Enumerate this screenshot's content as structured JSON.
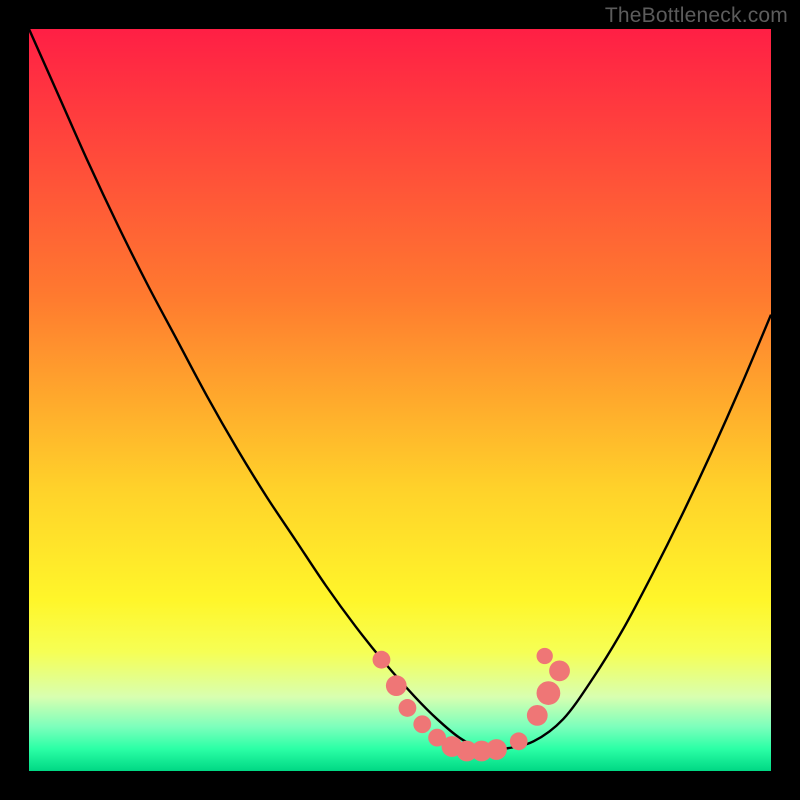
{
  "watermark": "TheBottleneck.com",
  "chart_data": {
    "type": "line",
    "title": "",
    "xlabel": "",
    "ylabel": "",
    "xlim": [
      0,
      100
    ],
    "ylim": [
      0,
      100
    ],
    "grid": false,
    "gradient_stops": [
      {
        "pct": 0,
        "color": "#ff1f45"
      },
      {
        "pct": 36,
        "color": "#ff7a2f"
      },
      {
        "pct": 62,
        "color": "#ffd22a"
      },
      {
        "pct": 77,
        "color": "#fff62a"
      },
      {
        "pct": 84,
        "color": "#f6ff55"
      },
      {
        "pct": 90,
        "color": "#d8ffb0"
      },
      {
        "pct": 94,
        "color": "#7dffbc"
      },
      {
        "pct": 97,
        "color": "#2bffa6"
      },
      {
        "pct": 100,
        "color": "#00d884"
      }
    ],
    "series": [
      {
        "name": "bottleneck-curve",
        "color": "#000000",
        "x": [
          0.0,
          4.0,
          8.0,
          12.0,
          16.0,
          20.0,
          24.0,
          28.0,
          32.0,
          36.0,
          40.0,
          44.0,
          48.0,
          52.0,
          55.0,
          58.0,
          61.0,
          64.0,
          68.0,
          72.0,
          76.0,
          80.0,
          84.0,
          88.0,
          92.0,
          96.0,
          100.0
        ],
        "y": [
          100.0,
          91.0,
          82.0,
          73.5,
          65.5,
          58.0,
          50.5,
          43.5,
          37.0,
          31.0,
          25.0,
          19.5,
          14.5,
          10.0,
          7.0,
          4.5,
          3.0,
          3.0,
          4.0,
          7.0,
          12.5,
          19.0,
          26.5,
          34.5,
          43.0,
          52.0,
          61.5
        ]
      }
    ],
    "markers": [
      {
        "x": 47.5,
        "y": 15.0,
        "r": 1.2,
        "color": "#ef7676"
      },
      {
        "x": 49.5,
        "y": 11.5,
        "r": 1.4,
        "color": "#ef7676"
      },
      {
        "x": 51.0,
        "y": 8.5,
        "r": 1.2,
        "color": "#ef7676"
      },
      {
        "x": 53.0,
        "y": 6.3,
        "r": 1.2,
        "color": "#ef7676"
      },
      {
        "x": 55.0,
        "y": 4.5,
        "r": 1.2,
        "color": "#ef7676"
      },
      {
        "x": 57.0,
        "y": 3.3,
        "r": 1.4,
        "color": "#ef7676"
      },
      {
        "x": 59.0,
        "y": 2.7,
        "r": 1.4,
        "color": "#ef7676"
      },
      {
        "x": 61.0,
        "y": 2.7,
        "r": 1.4,
        "color": "#ef7676"
      },
      {
        "x": 63.0,
        "y": 2.9,
        "r": 1.4,
        "color": "#ef7676"
      },
      {
        "x": 66.0,
        "y": 4.0,
        "r": 1.2,
        "color": "#ef7676"
      },
      {
        "x": 68.5,
        "y": 7.5,
        "r": 1.4,
        "color": "#ef7676"
      },
      {
        "x": 70.0,
        "y": 10.5,
        "r": 1.6,
        "color": "#ef7676"
      },
      {
        "x": 71.5,
        "y": 13.5,
        "r": 1.4,
        "color": "#ef7676"
      },
      {
        "x": 69.5,
        "y": 15.5,
        "r": 1.1,
        "color": "#ef7676"
      }
    ]
  }
}
